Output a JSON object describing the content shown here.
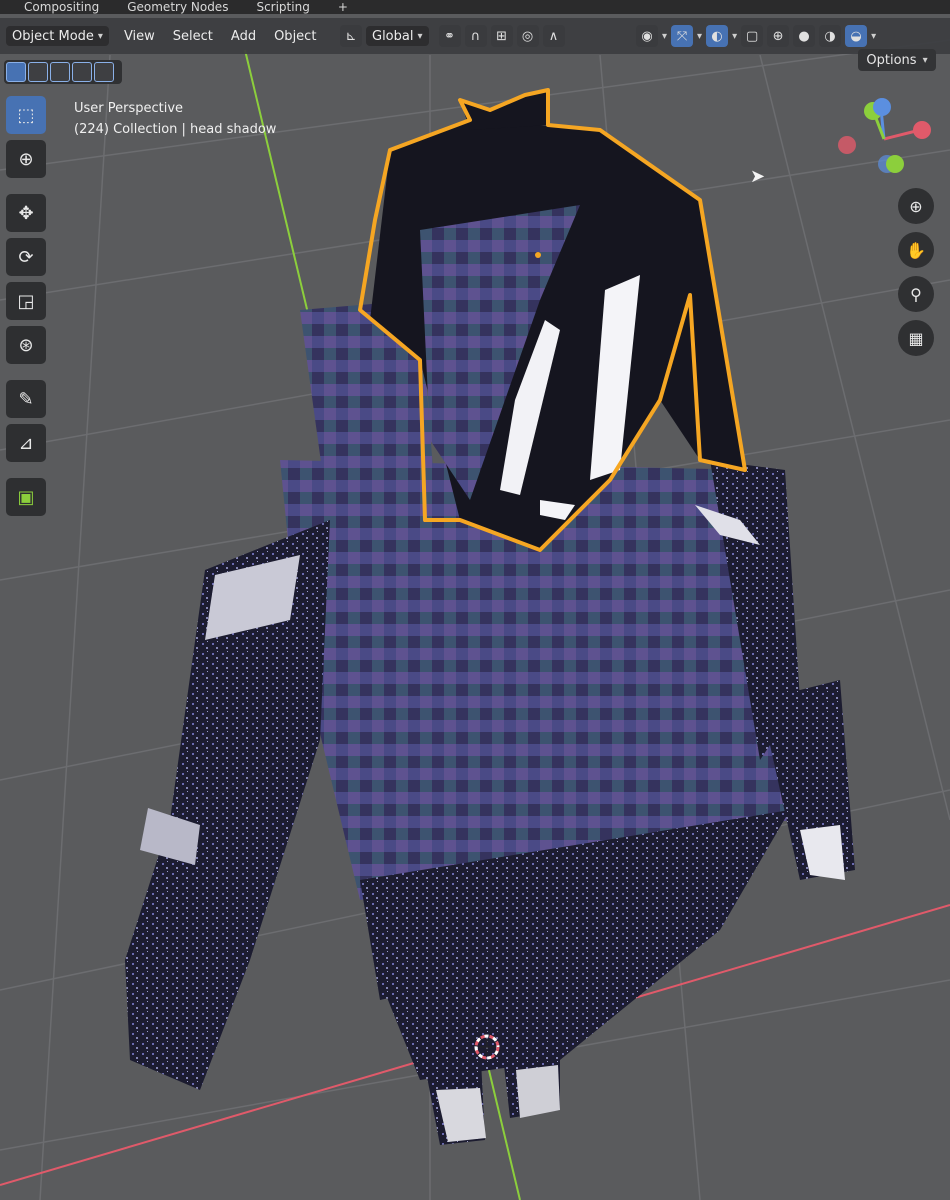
{
  "workspace_tabs": [
    "Compositing",
    "Geometry Nodes",
    "Scripting",
    "+"
  ],
  "header": {
    "mode": "Object Mode",
    "menus": [
      "View",
      "Select",
      "Add",
      "Object"
    ],
    "transform_orientation": "Global"
  },
  "options_label": "Options",
  "viewport": {
    "perspective": "User Perspective",
    "collection": "(224) Collection | head shadow"
  },
  "colors": {
    "selection_outline": "#f5a623",
    "x_axis": "#e05a6a",
    "y_axis": "#8ccf3c",
    "active_tool": "#4772b3"
  },
  "icons": {
    "toolbar": [
      "select-box-icon",
      "cursor-icon",
      "move-icon",
      "rotate-icon",
      "scale-icon",
      "transform-icon",
      "annotate-icon",
      "measure-icon",
      "add-cube-icon"
    ],
    "nav": [
      "zoom-icon",
      "pan-hand-icon",
      "camera-icon",
      "grid-ortho-icon"
    ]
  }
}
